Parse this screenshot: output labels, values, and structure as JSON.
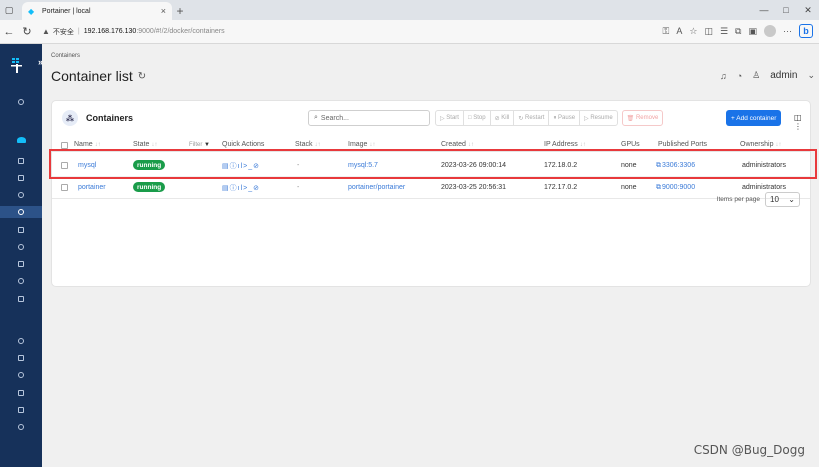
{
  "browser": {
    "tab_title": "Portainer | local",
    "tab_close": "×",
    "new_tab": "+",
    "insecure_label": "不安全",
    "url_host": "192.168.176.130",
    "url_path": ":9000/#!/2/docker/containers",
    "window_controls": [
      "—",
      "□",
      "✕"
    ]
  },
  "sidebar": {
    "collapse": "»"
  },
  "header": {
    "breadcrumb": "Containers",
    "title": "Container list",
    "user": "admin"
  },
  "card": {
    "title": "Containers",
    "search_placeholder": "Search...",
    "actions": [
      "Start",
      "Stop",
      "Kill",
      "Restart",
      "Pause",
      "Resume"
    ],
    "remove_label": "Remove",
    "add_label": "+ Add container"
  },
  "table": {
    "columns": {
      "name": "Name",
      "state": "State",
      "filter": "Filter",
      "quick_actions": "Quick Actions",
      "stack": "Stack",
      "image": "Image",
      "created": "Created",
      "ip": "IP Address",
      "gpus": "GPUs",
      "ports": "Published Ports",
      "ownership": "Ownership"
    },
    "rows": [
      {
        "name": "mysql",
        "state": "running",
        "stack": "-",
        "image": "mysql:5.7",
        "created": "2023-03-26 09:00:14",
        "ip": "172.18.0.2",
        "gpus": "none",
        "ports": "3306:3306",
        "ownership": "administrators"
      },
      {
        "name": "portainer",
        "state": "running",
        "stack": "-",
        "image": "portainer/portainer",
        "created": "2023-03-25 20:56:31",
        "ip": "172.17.0.2",
        "gpus": "none",
        "ports": "9000:9000",
        "ownership": "administrators"
      }
    ]
  },
  "pager": {
    "label": "Items per page",
    "value": "10"
  },
  "watermark": "CSDN @Bug_Dogg"
}
